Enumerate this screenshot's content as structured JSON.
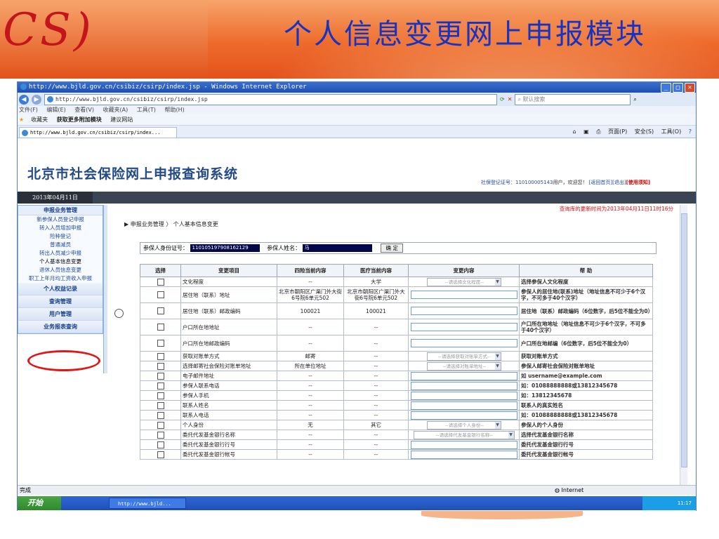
{
  "slide": {
    "logo_text": "CS)",
    "title": "个人信息变更网上申报模块"
  },
  "browser": {
    "window_title": "http://www.bjld.gov.cn/csibiz/csirp/index.jsp - Windows Internet Explorer",
    "address": "http://www.bjld.gov.cn/csibiz/csirp/index.jsp",
    "search_placeholder": "默认搜索",
    "menu": [
      "文件(F)",
      "编辑(E)",
      "查看(V)",
      "收藏夹(A)",
      "工具(T)",
      "帮助(H)"
    ],
    "favorites": [
      "收藏夹",
      "获取更多附加模块",
      "建议网站"
    ],
    "tab_label": "http://www.bjld.gov.cn/csibiz/csirp/index...",
    "tab_tools": [
      "页面(P)",
      "安全(S)",
      "工具(O)"
    ],
    "status_text": "完成",
    "zone_text": "Internet"
  },
  "site": {
    "title": "北京市社会保险网上申报查询系统",
    "user_prefix": "社保登记证号：",
    "user_number": "110100005143",
    "user_suffix": "用户，欢迎您！",
    "link_home": "[返回首页]",
    "link_logout": "[退出]",
    "link_notice": "使用须知",
    "date": "2013年04月11日"
  },
  "sidebar": {
    "head": "申报业务管理",
    "items": [
      "新参保人员登记申报",
      "转入人员增加申报",
      "险种登记",
      "普通减员",
      "转出人员减少申报",
      "个人基本信息变更",
      "退休人员信息变更",
      "职工上年月均工资收入申报"
    ],
    "groups": [
      "个人权益记录",
      "查询管理",
      "用户管理",
      "业务报表查询"
    ]
  },
  "main": {
    "update_notice": "查询库的更新时间为2013年04月11日11时16分",
    "breadcrumb": "申报业务管理 〉 个人基本信息变更",
    "id_label": "参保人身份证号：",
    "id_value": "110105197908162129",
    "name_label": "参保人姓名：",
    "name_value": "马",
    "confirm": "确 定"
  },
  "table": {
    "headers": [
      "选择",
      "变更项目",
      "四险当前内容",
      "医疗当前内容",
      "变更内容",
      "帮 助"
    ],
    "rows": [
      {
        "item": "文化程度",
        "four": "--",
        "med": "大学",
        "change": "--请选择文化程度--",
        "help": "选择参保人文化程度"
      },
      {
        "item": "居住地（联系）地址",
        "four": "北京市朝阳区广渠门外大街6号院6单元502",
        "med": "北京市朝阳区广渠门外大街6号院6单元502",
        "change": "",
        "help": "参保人的居住地(联系)地址（地址信息不可少于6个汉字，不可多于40个汉字）"
      },
      {
        "item": "居住地（联系）邮政编码",
        "four": "100021",
        "med": "100021",
        "change": "",
        "help": "居住地（联系）邮政编码（6位数字，后5位不能全为0）"
      },
      {
        "item": "户口所在地地址",
        "four": "--",
        "med": "--",
        "change": "",
        "help": "户口所在地地址（地址信息不可少于6个汉字，不可多于40个汉字）"
      },
      {
        "item": "户口所在地邮政编码",
        "four": "--",
        "med": "--",
        "change": "",
        "help": "户口所在地邮编（6位数字，后5位不能全为0）"
      },
      {
        "item": "获取对账单方式",
        "four": "邮寄",
        "med": "--",
        "change": "--请选择获取对账单方式--",
        "help": "获取对账单方式"
      },
      {
        "item": "选择邮寄社会保险对账单地址",
        "four": "所在单位地址",
        "med": "--",
        "change": "--请选择对账单地址--",
        "help": "参保人邮寄社会保险对账单地址"
      },
      {
        "item": "电子邮件地址",
        "four": "--",
        "med": "--",
        "change": "",
        "help": "如 username@example.com"
      },
      {
        "item": "参保人联系电话",
        "four": "--",
        "med": "--",
        "change": "",
        "help": "如：01088888888或13812345678"
      },
      {
        "item": "参保人手机",
        "four": "--",
        "med": "--",
        "change": "",
        "help": "如：13812345678"
      },
      {
        "item": "联系人姓名",
        "four": "--",
        "med": "--",
        "change": "",
        "help": "联系人的真实姓名"
      },
      {
        "item": "联系人电话",
        "four": "--",
        "med": "--",
        "change": "",
        "help": "如：01088888888或13812345678"
      },
      {
        "item": "个人身份",
        "four": "无",
        "med": "其它",
        "change": "--请选择个人身份--",
        "help": "参保人的个人身份"
      },
      {
        "item": "委托代发基金银行名称",
        "four": "--",
        "med": "--",
        "change": "--请选择代发基金银行名称--",
        "help": "选择代发基金银行名称"
      },
      {
        "item": "委托代发基金银行行号",
        "four": "--",
        "med": "--",
        "change": "",
        "help": "委托代发基金银行行号"
      },
      {
        "item": "委托代发基金银行帐号",
        "four": "--",
        "med": "--",
        "change": "",
        "help": "委托代发基金银行帐号"
      }
    ]
  },
  "taskbar": {
    "start": "开始",
    "task": "http://www.bjld...",
    "clock": "11:17"
  }
}
